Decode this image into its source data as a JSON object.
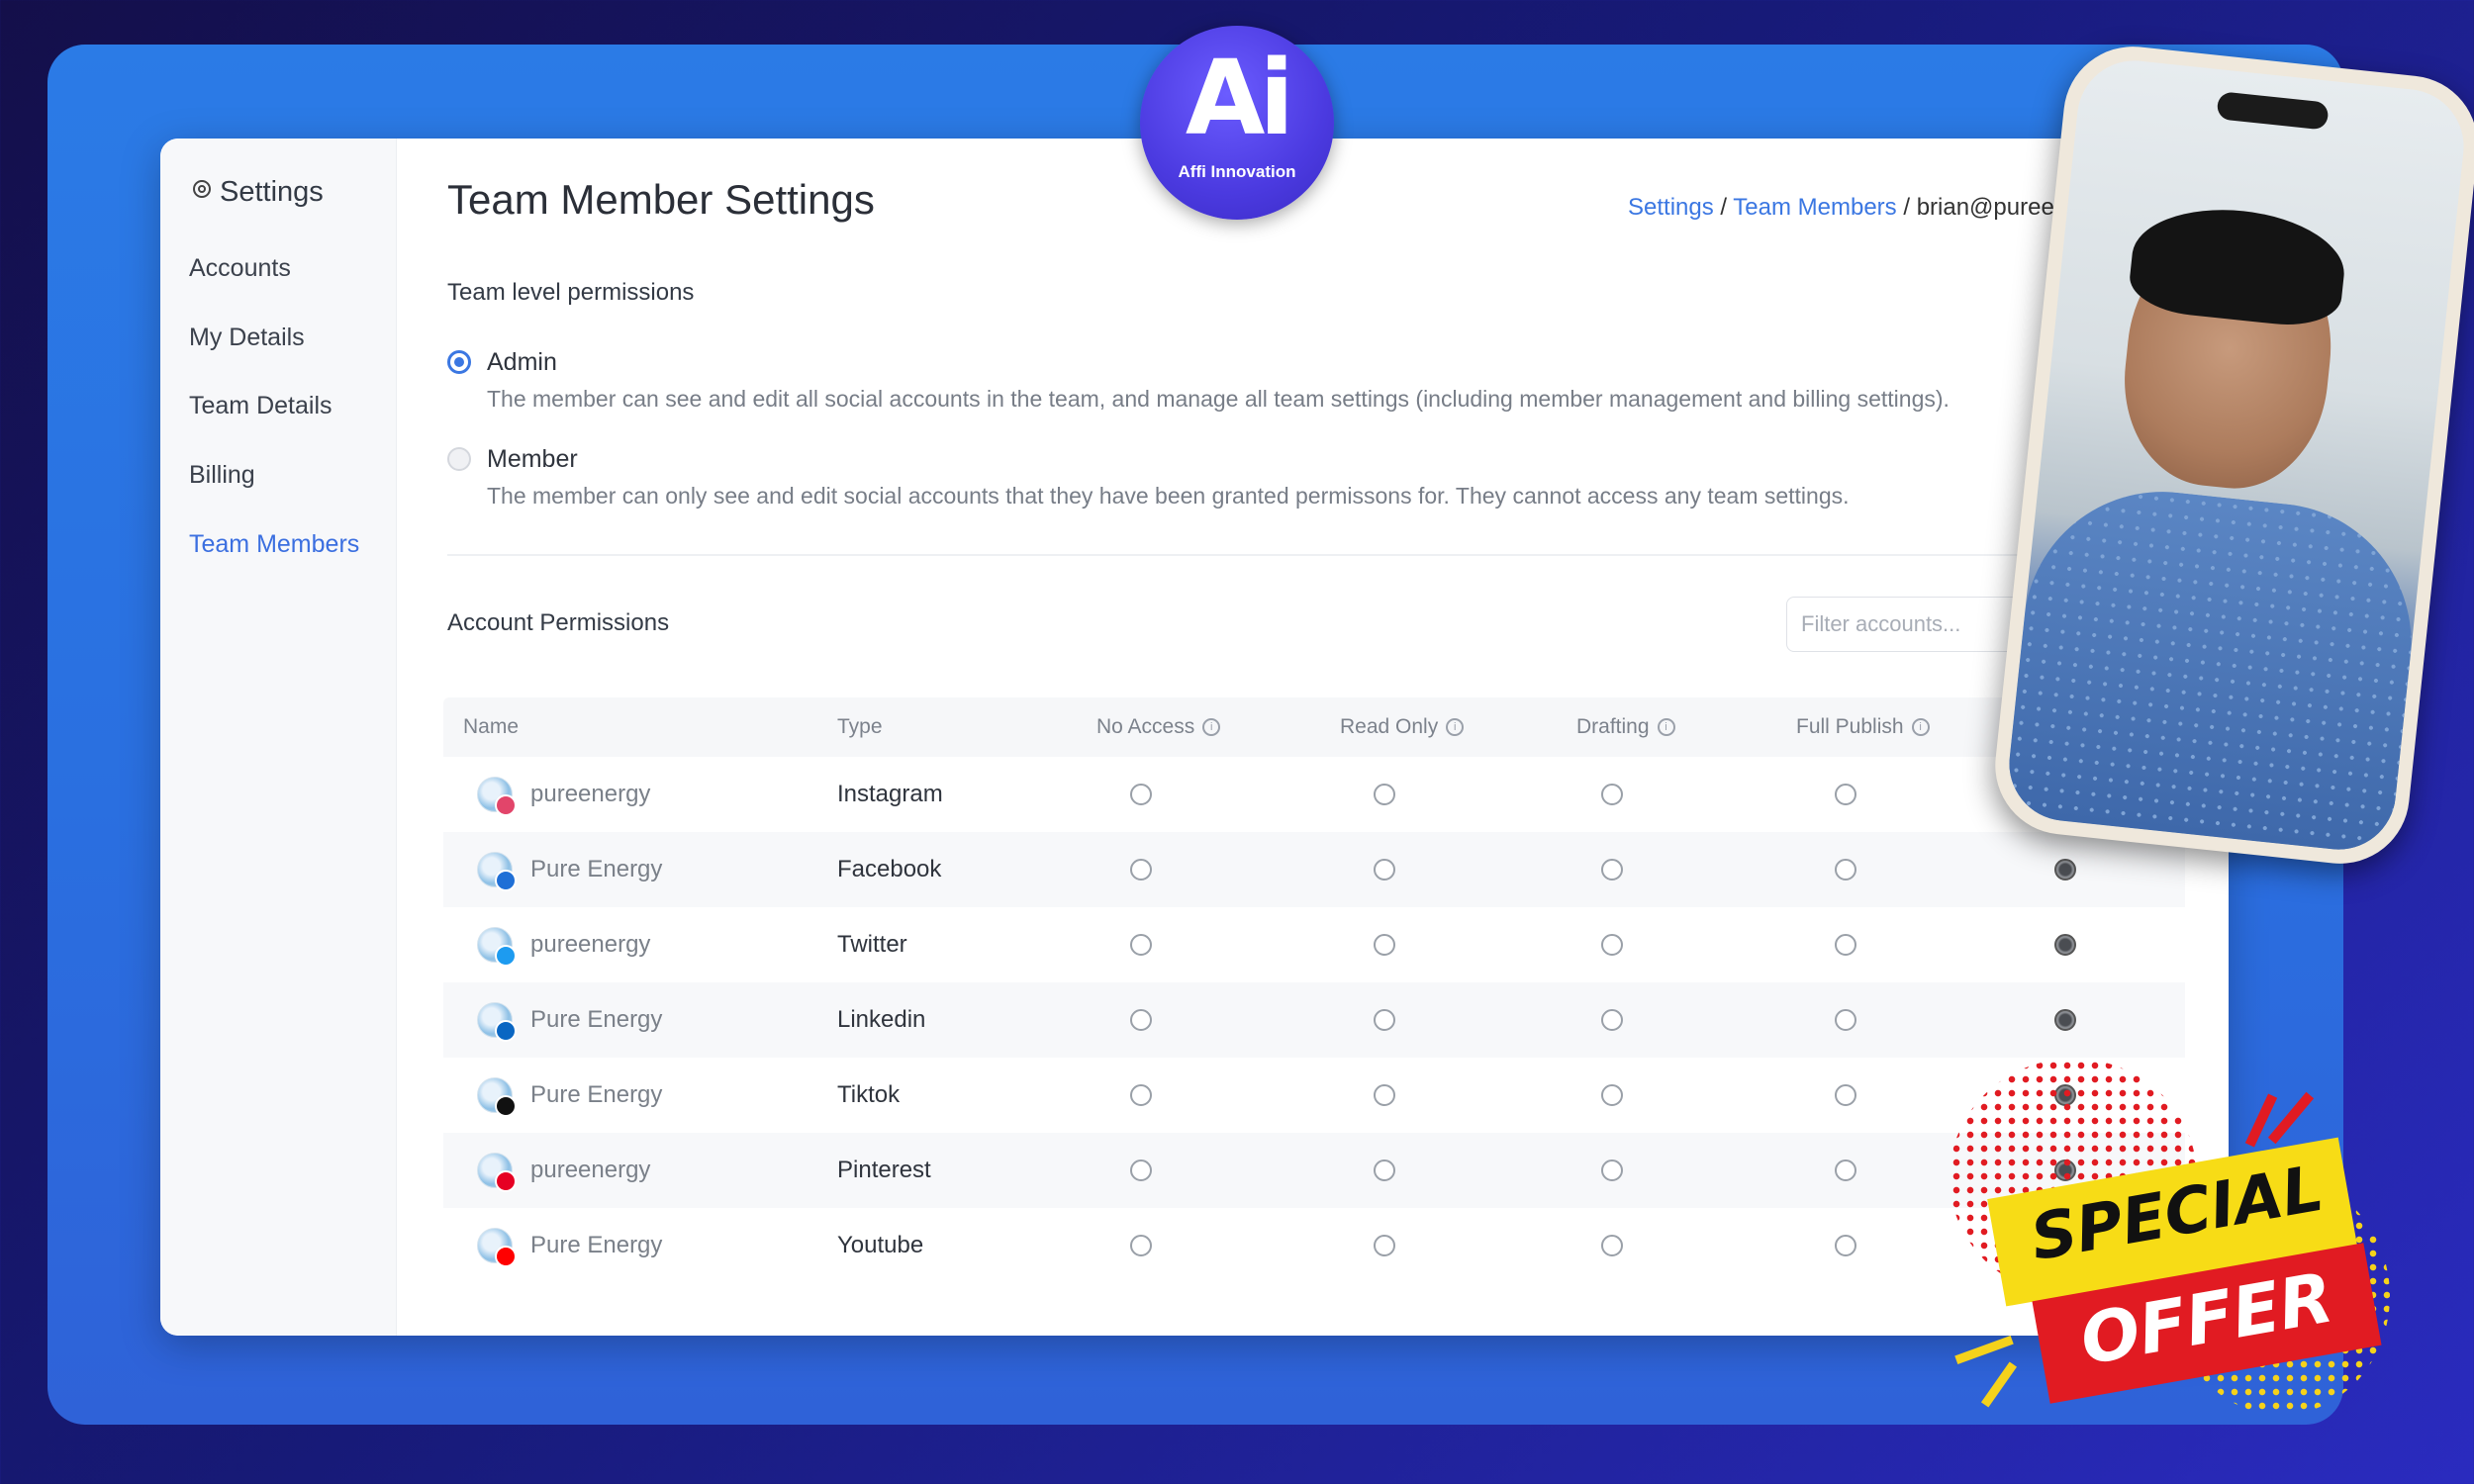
{
  "sidebar": {
    "title": "Settings",
    "items": [
      {
        "label": "Accounts"
      },
      {
        "label": "My Details"
      },
      {
        "label": "Team Details"
      },
      {
        "label": "Billing"
      },
      {
        "label": "Team Members",
        "active": true
      }
    ]
  },
  "header": {
    "title": "Team Member Settings",
    "breadcrumb": {
      "settings": "Settings",
      "sep1": " / ",
      "team_members": "Team Members",
      "sep2": " / ",
      "current": "brian@pureene"
    }
  },
  "team_permissions": {
    "label": "Team level permissions",
    "options": [
      {
        "title": "Admin",
        "selected": true,
        "description": "The member can see and edit all social accounts in the team, and manage all team settings (including member management and billing settings)."
      },
      {
        "title": "Member",
        "selected": false,
        "description": "The member can only see and edit social accounts that they have been granted permissons for. They cannot access any team settings."
      }
    ]
  },
  "account_permissions": {
    "label": "Account Permissions",
    "filter_placeholder": "Filter accounts...",
    "columns": [
      "Name",
      "Type",
      "No Access",
      "Read Only",
      "Drafting",
      "Full Publish"
    ],
    "rows": [
      {
        "name": "pureenergy",
        "type": "Instagram",
        "badge_color": "#e2456a",
        "selected_col": null
      },
      {
        "name": "Pure Energy",
        "type": "Facebook",
        "badge_color": "#1f6fd6",
        "selected_col": 4
      },
      {
        "name": "pureenergy",
        "type": "Twitter",
        "badge_color": "#1d9bf0",
        "selected_col": 4
      },
      {
        "name": "Pure Energy",
        "type": "Linkedin",
        "badge_color": "#0a66c2",
        "selected_col": 4
      },
      {
        "name": "Pure Energy",
        "type": "Tiktok",
        "badge_color": "#111111",
        "selected_col": 4
      },
      {
        "name": "pureenergy",
        "type": "Pinterest",
        "badge_color": "#e60023",
        "selected_col": 4
      },
      {
        "name": "Pure Energy",
        "type": "Youtube",
        "badge_color": "#ff0000",
        "selected_col": 4
      }
    ]
  },
  "logo": {
    "mark": "Ai",
    "name": "Affi Innovation"
  },
  "offer": {
    "line1": "SPECIAL",
    "line2": "OFFER"
  },
  "colors": {
    "accent": "#3b77e2",
    "background": "#2a6fe0"
  }
}
